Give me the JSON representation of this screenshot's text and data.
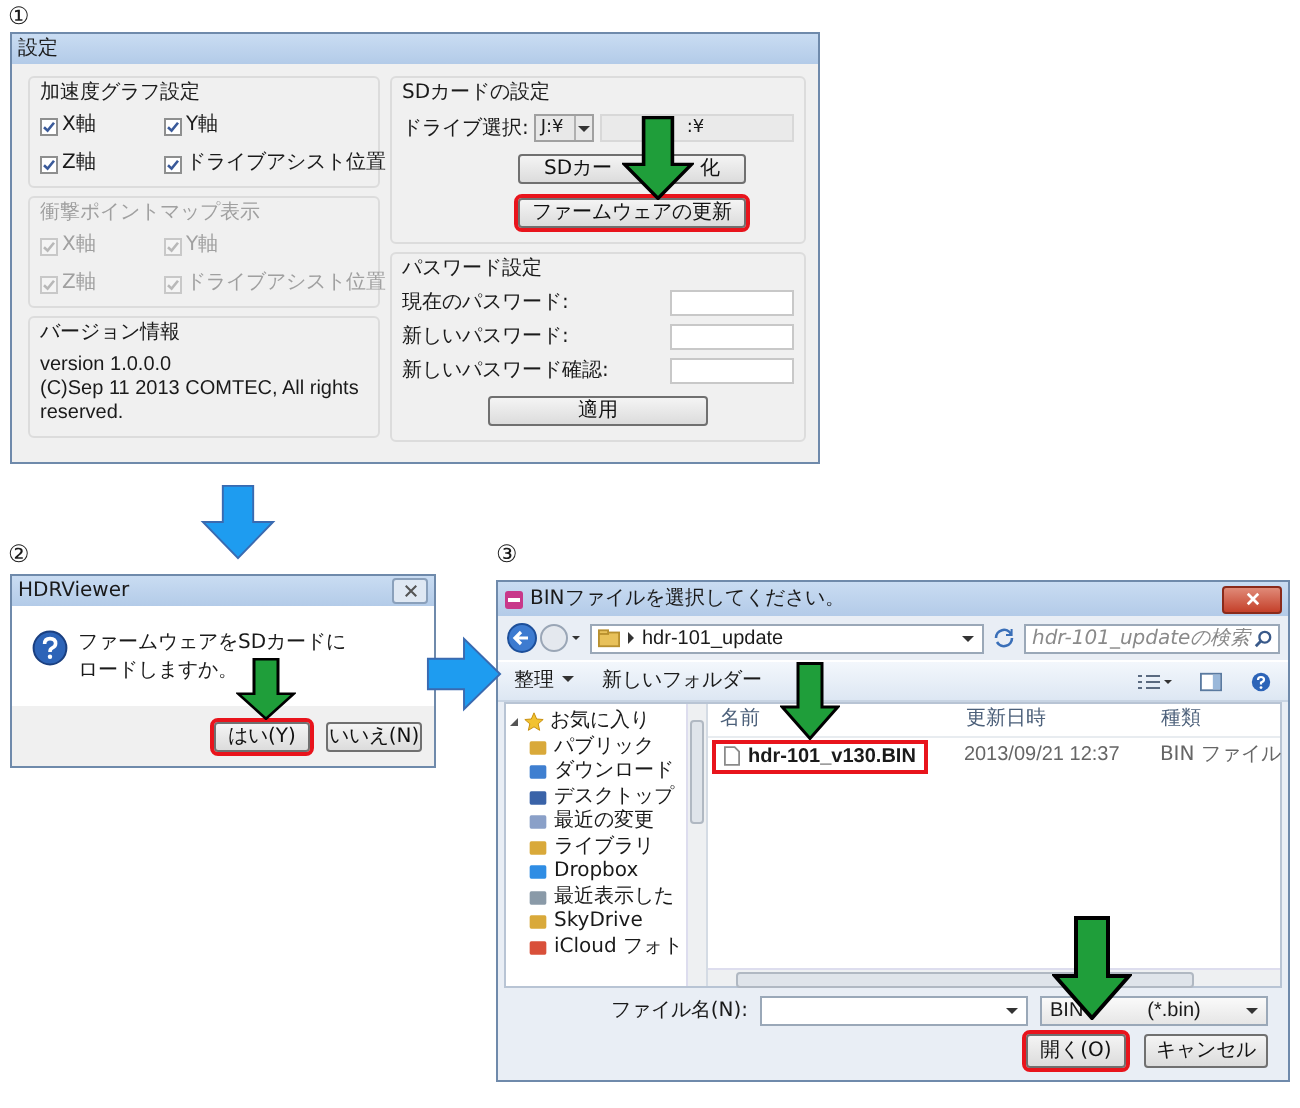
{
  "steps": [
    "①",
    "②",
    "③"
  ],
  "settings_window": {
    "title": "設定",
    "groups": [
      {
        "title": "加速度グラフ設定",
        "disabled": false,
        "checkboxes": [
          {
            "label": "X軸",
            "checked": true
          },
          {
            "label": "Y軸",
            "checked": true
          },
          {
            "label": "Z軸",
            "checked": true
          },
          {
            "label": "ドライブアシスト位置",
            "checked": true
          }
        ]
      },
      {
        "title": "衝撃ポイントマップ表示",
        "disabled": true,
        "checkboxes": [
          {
            "label": "X軸",
            "checked": true
          },
          {
            "label": "Y軸",
            "checked": true
          },
          {
            "label": "Z軸",
            "checked": true
          },
          {
            "label": "ドライブアシスト位置",
            "checked": true
          }
        ]
      }
    ],
    "version": {
      "title": "バージョン情報",
      "text": "version 1.0.0.0\n(C)Sep 11 2013 COMTEC, All rights reserved."
    },
    "sd_card": {
      "title": "SDカードの設定",
      "drive_label": "ドライブ選択:",
      "drive_value": "J:¥",
      "path_value": ":¥",
      "buttons": [
        {
          "parts": [
            "SDカー",
            "化"
          ],
          "marked": false
        },
        {
          "parts": [
            "ファームウェアの更新"
          ],
          "marked": true
        }
      ]
    },
    "password": {
      "title": "パスワード設定",
      "fields": [
        {
          "label": "現在のパスワード:"
        },
        {
          "label": "新しいパスワード:"
        },
        {
          "label": "新しいパスワード確認:"
        }
      ],
      "apply": "適用"
    }
  },
  "confirm_dialog": {
    "title": "HDRViewer",
    "message_parts": [
      "ファームウェアをSDカードに",
      "ロードしますか。"
    ],
    "buttons": [
      {
        "label": "はい(Y)",
        "marked": true
      },
      {
        "label": "いいえ(N)",
        "marked": false
      }
    ]
  },
  "file_dialog": {
    "title": "BINファイルを選択してください。",
    "path": "hdr-101_update",
    "search": {
      "placeholder": "hdr-101_updateの検索"
    },
    "toolbar": {
      "organize": "整理",
      "new_folder": "新しいフォルダー"
    },
    "nav": [
      {
        "label": "お気に入り",
        "expanded": true,
        "children": [
          {
            "label": "パブリック"
          },
          {
            "label": "ダウンロード"
          },
          {
            "label": "デスクトップ"
          },
          {
            "label": "最近の変更"
          },
          {
            "label": "ライブラリ"
          },
          {
            "label": "Dropbox"
          },
          {
            "label": "最近表示した"
          },
          {
            "label": "SkyDrive"
          },
          {
            "label": "iCloud フォト"
          }
        ]
      }
    ],
    "columns": [
      "名前",
      "更新日時",
      "種類"
    ],
    "rows": [
      {
        "name": "hdr-101_v130.BIN",
        "modified": "2013/09/21 12:37",
        "type": "BIN ファイル",
        "marked": true
      }
    ],
    "filename_label": "ファイル名(N):",
    "filetype_parts": [
      "BIN",
      "(*.bin)"
    ],
    "buttons": [
      {
        "label": "開く(O)",
        "marked": true
      },
      {
        "label": "キャンセル",
        "marked": false
      }
    ]
  }
}
